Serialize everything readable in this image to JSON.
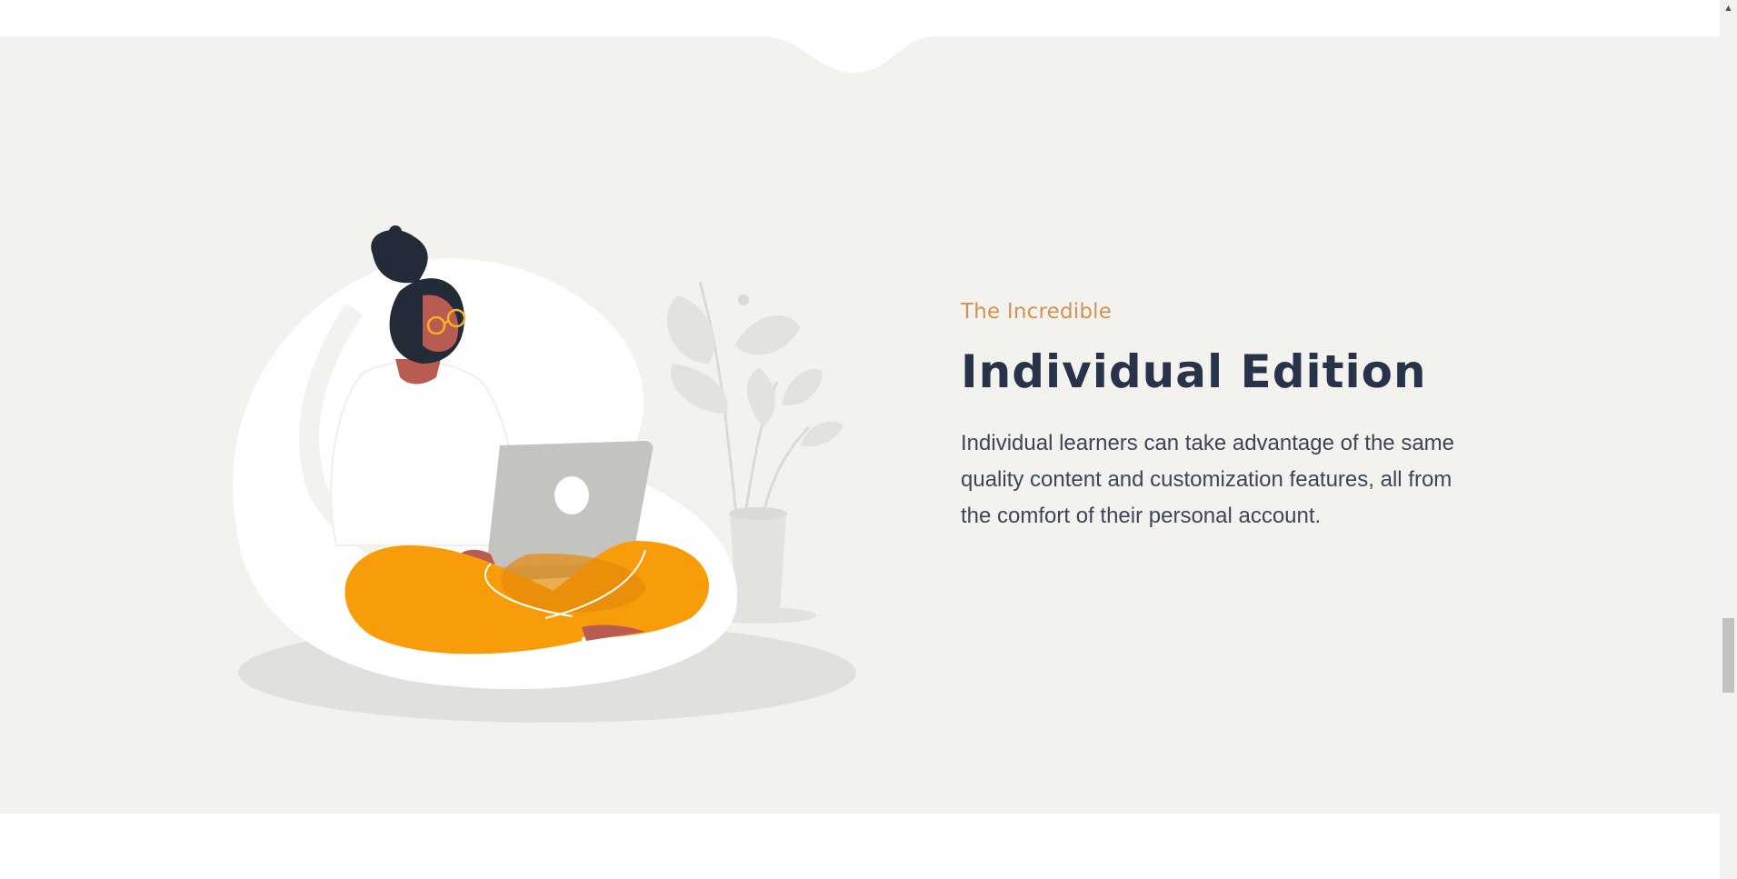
{
  "hero": {
    "eyebrow": "The Incredible",
    "heading": "Individual Edition",
    "description": "Individual learners can take advantage of the same quality content and customization features, all from the comfort of their personal account."
  },
  "illustration": {
    "icon": "woman-with-laptop-illustration",
    "colors": {
      "background": "#f3f2ef",
      "beanbag": "#ffffff",
      "shadow": "#e2e0dc",
      "pants": "#f99c0a",
      "hair": "#232b38",
      "skin": "#b95b51",
      "laptop": "#c4c3c0",
      "plant": "#e4e2de"
    }
  },
  "colors": {
    "accent": "#cf9452",
    "heading": "#28334a",
    "body_text": "#3c4656",
    "section_bg": "#f3f2ef"
  },
  "scrollbar": {
    "up_arrow_icon": "scroll-up-arrow-icon",
    "up_arrow_glyph": "▲"
  }
}
